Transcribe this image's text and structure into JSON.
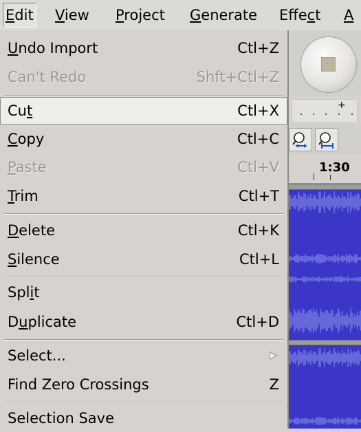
{
  "menubar": {
    "edit": {
      "pre": "",
      "u": "E",
      "post": "dit"
    },
    "view": {
      "pre": "",
      "u": "V",
      "post": "iew"
    },
    "project": {
      "pre": "",
      "u": "P",
      "post": "roject"
    },
    "generate": {
      "pre": "",
      "u": "G",
      "post": "enerate"
    },
    "effect": {
      "pre": "Effe",
      "u": "c",
      "post": "t"
    },
    "next": {
      "pre": "",
      "u": "A",
      "post": ""
    }
  },
  "edit_menu": {
    "undo": {
      "pre": "",
      "u": "U",
      "post": "ndo Import",
      "shortcut": "Ctl+Z"
    },
    "redo": {
      "pre": "",
      "u": "",
      "post": "Can't Redo",
      "shortcut": "Shft+Ctl+Z"
    },
    "cut": {
      "pre": "Cu",
      "u": "t",
      "post": "",
      "shortcut": "Ctl+X"
    },
    "copy": {
      "pre": "",
      "u": "C",
      "post": "opy",
      "shortcut": "Ctl+C"
    },
    "paste": {
      "pre": "",
      "u": "P",
      "post": "aste",
      "shortcut": "Ctl+V"
    },
    "trim": {
      "pre": "",
      "u": "T",
      "post": "rim",
      "shortcut": "Ctl+T"
    },
    "delete": {
      "pre": "",
      "u": "D",
      "post": "elete",
      "shortcut": "Ctl+K"
    },
    "silence": {
      "pre": "",
      "u": "S",
      "post": "ilence",
      "shortcut": "Ctl+L"
    },
    "split": {
      "pre": "Spl",
      "u": "i",
      "post": "t",
      "shortcut": ""
    },
    "duplicate": {
      "pre": "D",
      "u": "u",
      "post": "plicate",
      "shortcut": "Ctl+D"
    },
    "select": {
      "pre": "",
      "u": "",
      "post": "Select...",
      "shortcut": ""
    },
    "zero": {
      "pre": "",
      "u": "",
      "post": "Find Zero Crossings",
      "shortcut": "Z"
    },
    "selsave": {
      "pre": "",
      "u": "",
      "post": "Selection Save",
      "shortcut": ""
    }
  },
  "ruler": {
    "label": "1:30"
  },
  "meter": {
    "plus": "+"
  },
  "icons": {
    "stop": "stop-icon",
    "zoom_fit": "zoom-fit-icon",
    "zoom_selection": "zoom-selection-icon",
    "submenu": "submenu-arrow-icon"
  },
  "colors": {
    "waveform": "#3b36c8",
    "menu_bg": "#d6d3ce",
    "highlight": "#efeeeb",
    "disabled": "#9a9995"
  }
}
